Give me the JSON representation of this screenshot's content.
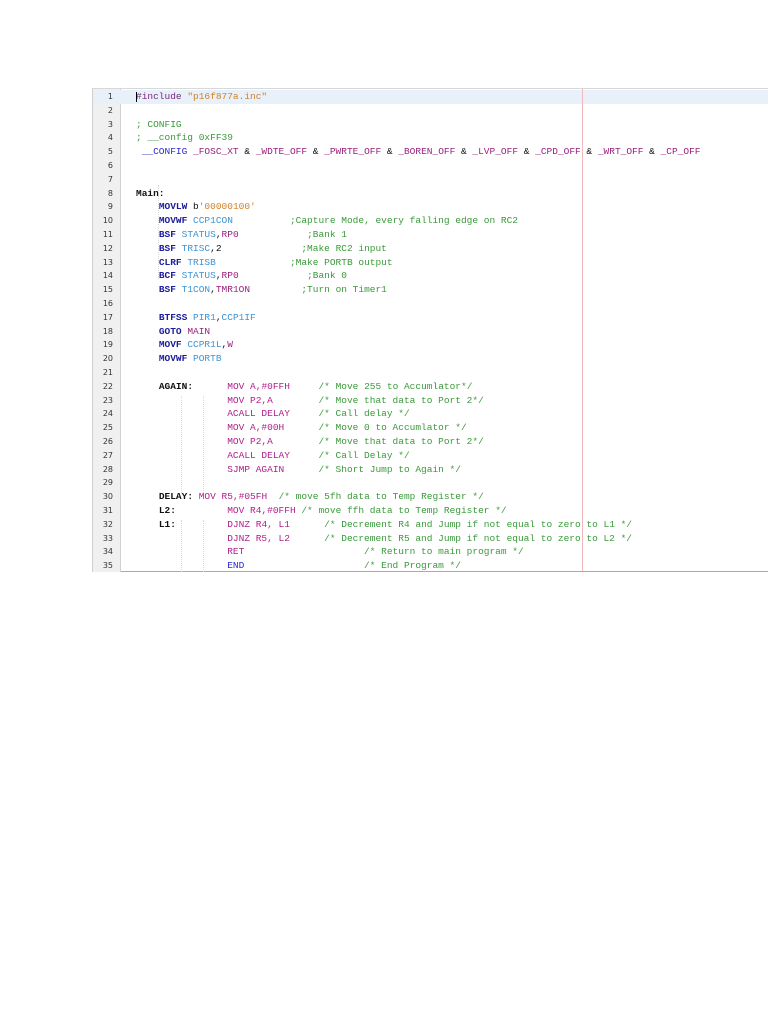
{
  "editor": {
    "lines": [
      {
        "n": "1",
        "tokens": [
          {
            "t": "#include ",
            "c": "pre"
          },
          {
            "t": "\"p16f877a.inc\"",
            "c": "str"
          }
        ]
      },
      {
        "n": "2",
        "tokens": []
      },
      {
        "n": "3",
        "tokens": [
          {
            "t": "; CONFIG",
            "c": "cmt"
          }
        ]
      },
      {
        "n": "4",
        "tokens": [
          {
            "t": "; __config 0xFF39",
            "c": "cmt"
          }
        ]
      },
      {
        "n": "5",
        "tokens": [
          {
            "t": " __CONFIG",
            "c": "dir"
          },
          {
            "t": " ",
            "c": "plain"
          },
          {
            "t": "_FOSC_XT",
            "c": "sym"
          },
          {
            "t": " & ",
            "c": "plain"
          },
          {
            "t": "_WDTE_OFF",
            "c": "sym"
          },
          {
            "t": " & ",
            "c": "plain"
          },
          {
            "t": "_PWRTE_OFF",
            "c": "sym"
          },
          {
            "t": " & ",
            "c": "plain"
          },
          {
            "t": "_BOREN_OFF",
            "c": "sym"
          },
          {
            "t": " & ",
            "c": "plain"
          },
          {
            "t": "_LVP_OFF",
            "c": "sym"
          },
          {
            "t": " & ",
            "c": "plain"
          },
          {
            "t": "_CPD_OFF",
            "c": "sym"
          },
          {
            "t": " & ",
            "c": "plain"
          },
          {
            "t": "_WRT_OFF",
            "c": "sym"
          },
          {
            "t": " & ",
            "c": "plain"
          },
          {
            "t": "_CP_OFF",
            "c": "sym"
          }
        ]
      },
      {
        "n": "6",
        "tokens": []
      },
      {
        "n": "7",
        "tokens": []
      },
      {
        "n": "8",
        "tokens": [
          {
            "t": "Main:",
            "c": "lbl"
          }
        ]
      },
      {
        "n": "9",
        "tokens": [
          {
            "t": "    ",
            "c": "plain"
          },
          {
            "t": "MOVLW",
            "c": "kw"
          },
          {
            "t": " b",
            "c": "plain"
          },
          {
            "t": "'00000100'",
            "c": "str"
          }
        ]
      },
      {
        "n": "10",
        "tokens": [
          {
            "t": "    ",
            "c": "plain"
          },
          {
            "t": "MOVWF",
            "c": "kw"
          },
          {
            "t": " ",
            "c": "plain"
          },
          {
            "t": "CCP1CON          ",
            "c": "reg"
          },
          {
            "t": ";Capture Mode, every falling edge on RC2",
            "c": "cmt"
          }
        ]
      },
      {
        "n": "11",
        "tokens": [
          {
            "t": "    ",
            "c": "plain"
          },
          {
            "t": "BSF",
            "c": "kw"
          },
          {
            "t": " ",
            "c": "plain"
          },
          {
            "t": "STATUS",
            "c": "reg"
          },
          {
            "t": ",",
            "c": "plain"
          },
          {
            "t": "RP0            ",
            "c": "sym"
          },
          {
            "t": ";Bank 1",
            "c": "cmt"
          }
        ]
      },
      {
        "n": "12",
        "tokens": [
          {
            "t": "    ",
            "c": "plain"
          },
          {
            "t": "BSF",
            "c": "kw"
          },
          {
            "t": " ",
            "c": "plain"
          },
          {
            "t": "TRISC",
            "c": "reg"
          },
          {
            "t": ",2              ",
            "c": "plain"
          },
          {
            "t": ";Make RC2 input",
            "c": "cmt"
          }
        ]
      },
      {
        "n": "13",
        "tokens": [
          {
            "t": "    ",
            "c": "plain"
          },
          {
            "t": "CLRF",
            "c": "kw"
          },
          {
            "t": " ",
            "c": "plain"
          },
          {
            "t": "TRISB             ",
            "c": "reg"
          },
          {
            "t": ";Make PORTB output",
            "c": "cmt"
          }
        ]
      },
      {
        "n": "14",
        "tokens": [
          {
            "t": "    ",
            "c": "plain"
          },
          {
            "t": "BCF",
            "c": "kw"
          },
          {
            "t": " ",
            "c": "plain"
          },
          {
            "t": "STATUS",
            "c": "reg"
          },
          {
            "t": ",",
            "c": "plain"
          },
          {
            "t": "RP0            ",
            "c": "sym"
          },
          {
            "t": ";Bank 0",
            "c": "cmt"
          }
        ]
      },
      {
        "n": "15",
        "tokens": [
          {
            "t": "    ",
            "c": "plain"
          },
          {
            "t": "BSF",
            "c": "kw"
          },
          {
            "t": " ",
            "c": "plain"
          },
          {
            "t": "T1CON",
            "c": "reg"
          },
          {
            "t": ",",
            "c": "plain"
          },
          {
            "t": "TMR1ON         ",
            "c": "sym"
          },
          {
            "t": ";Turn on Timer1",
            "c": "cmt"
          }
        ]
      },
      {
        "n": "16",
        "tokens": []
      },
      {
        "n": "17",
        "tokens": [
          {
            "t": "    ",
            "c": "plain"
          },
          {
            "t": "BTFSS",
            "c": "kw"
          },
          {
            "t": " ",
            "c": "plain"
          },
          {
            "t": "PIR1",
            "c": "reg"
          },
          {
            "t": ",",
            "c": "plain"
          },
          {
            "t": "CCP1IF",
            "c": "reg"
          }
        ]
      },
      {
        "n": "18",
        "tokens": [
          {
            "t": "    ",
            "c": "plain"
          },
          {
            "t": "GOTO",
            "c": "kw"
          },
          {
            "t": " ",
            "c": "plain"
          },
          {
            "t": "MAIN",
            "c": "sym"
          }
        ]
      },
      {
        "n": "19",
        "tokens": [
          {
            "t": "    ",
            "c": "plain"
          },
          {
            "t": "MOVF",
            "c": "kw"
          },
          {
            "t": " ",
            "c": "plain"
          },
          {
            "t": "CCPR1L",
            "c": "reg"
          },
          {
            "t": ",",
            "c": "plain"
          },
          {
            "t": "W",
            "c": "sym"
          }
        ]
      },
      {
        "n": "20",
        "tokens": [
          {
            "t": "    ",
            "c": "plain"
          },
          {
            "t": "MOVWF",
            "c": "kw"
          },
          {
            "t": " ",
            "c": "plain"
          },
          {
            "t": "PORTB",
            "c": "reg"
          }
        ]
      },
      {
        "n": "21",
        "tokens": []
      },
      {
        "n": "22",
        "tokens": [
          {
            "t": "    ",
            "c": "plain"
          },
          {
            "t": "AGAIN:",
            "c": "lbl"
          },
          {
            "t": "      ",
            "c": "plain"
          },
          {
            "t": "MOV A,#0FFH     ",
            "c": "ins"
          },
          {
            "t": "/* Move 255 to Accumlator*/",
            "c": "cmt"
          }
        ]
      },
      {
        "n": "23",
        "tokens": [
          {
            "t": "                ",
            "c": "plain"
          },
          {
            "t": "MOV P2,A        ",
            "c": "ins"
          },
          {
            "t": "/* Move that data to Port 2*/",
            "c": "cmt"
          }
        ]
      },
      {
        "n": "24",
        "tokens": [
          {
            "t": "                ",
            "c": "plain"
          },
          {
            "t": "ACALL DELAY     ",
            "c": "ins"
          },
          {
            "t": "/* Call delay */",
            "c": "cmt"
          }
        ]
      },
      {
        "n": "25",
        "tokens": [
          {
            "t": "                ",
            "c": "plain"
          },
          {
            "t": "MOV A,#00H      ",
            "c": "ins"
          },
          {
            "t": "/* Move 0 to Accumlator */",
            "c": "cmt"
          }
        ]
      },
      {
        "n": "26",
        "tokens": [
          {
            "t": "                ",
            "c": "plain"
          },
          {
            "t": "MOV P2,A        ",
            "c": "ins"
          },
          {
            "t": "/* Move that data to Port 2*/",
            "c": "cmt"
          }
        ]
      },
      {
        "n": "27",
        "tokens": [
          {
            "t": "                ",
            "c": "plain"
          },
          {
            "t": "ACALL DELAY     ",
            "c": "ins"
          },
          {
            "t": "/* Call Delay */",
            "c": "cmt"
          }
        ]
      },
      {
        "n": "28",
        "tokens": [
          {
            "t": "                ",
            "c": "plain"
          },
          {
            "t": "SJMP AGAIN      ",
            "c": "ins"
          },
          {
            "t": "/* Short Jump to Again */",
            "c": "cmt"
          }
        ]
      },
      {
        "n": "29",
        "tokens": []
      },
      {
        "n": "30",
        "tokens": [
          {
            "t": "    ",
            "c": "plain"
          },
          {
            "t": "DELAY:",
            "c": "lbl"
          },
          {
            "t": " ",
            "c": "plain"
          },
          {
            "t": "MOV R5,#05FH  ",
            "c": "ins"
          },
          {
            "t": "/* move 5fh data to Temp Register */",
            "c": "cmt"
          }
        ]
      },
      {
        "n": "31",
        "tokens": [
          {
            "t": "    ",
            "c": "plain"
          },
          {
            "t": "L2:",
            "c": "lbl"
          },
          {
            "t": "         ",
            "c": "plain"
          },
          {
            "t": "MOV R4,#0FFH ",
            "c": "ins"
          },
          {
            "t": "/* move ffh data to Temp Register */",
            "c": "cmt"
          }
        ]
      },
      {
        "n": "32",
        "tokens": [
          {
            "t": "    ",
            "c": "plain"
          },
          {
            "t": "L1:",
            "c": "lbl"
          },
          {
            "t": "         ",
            "c": "plain"
          },
          {
            "t": "DJNZ R4, L1      ",
            "c": "ins"
          },
          {
            "t": "/* Decrement R4 and Jump if not equal to zero to L1 */",
            "c": "cmt"
          }
        ]
      },
      {
        "n": "33",
        "tokens": [
          {
            "t": "                ",
            "c": "plain"
          },
          {
            "t": "DJNZ R5, L2      ",
            "c": "ins"
          },
          {
            "t": "/* Decrement R5 and Jump if not equal to zero to L2 */",
            "c": "cmt"
          }
        ]
      },
      {
        "n": "34",
        "tokens": [
          {
            "t": "                ",
            "c": "plain"
          },
          {
            "t": "RET                     ",
            "c": "ins"
          },
          {
            "t": "/* Return to main program */",
            "c": "cmt"
          }
        ]
      },
      {
        "n": "35",
        "tokens": [
          {
            "t": "                ",
            "c": "plain"
          },
          {
            "t": "END                     ",
            "c": "dir"
          },
          {
            "t": "/* End Program */",
            "c": "cmt"
          }
        ]
      }
    ]
  }
}
